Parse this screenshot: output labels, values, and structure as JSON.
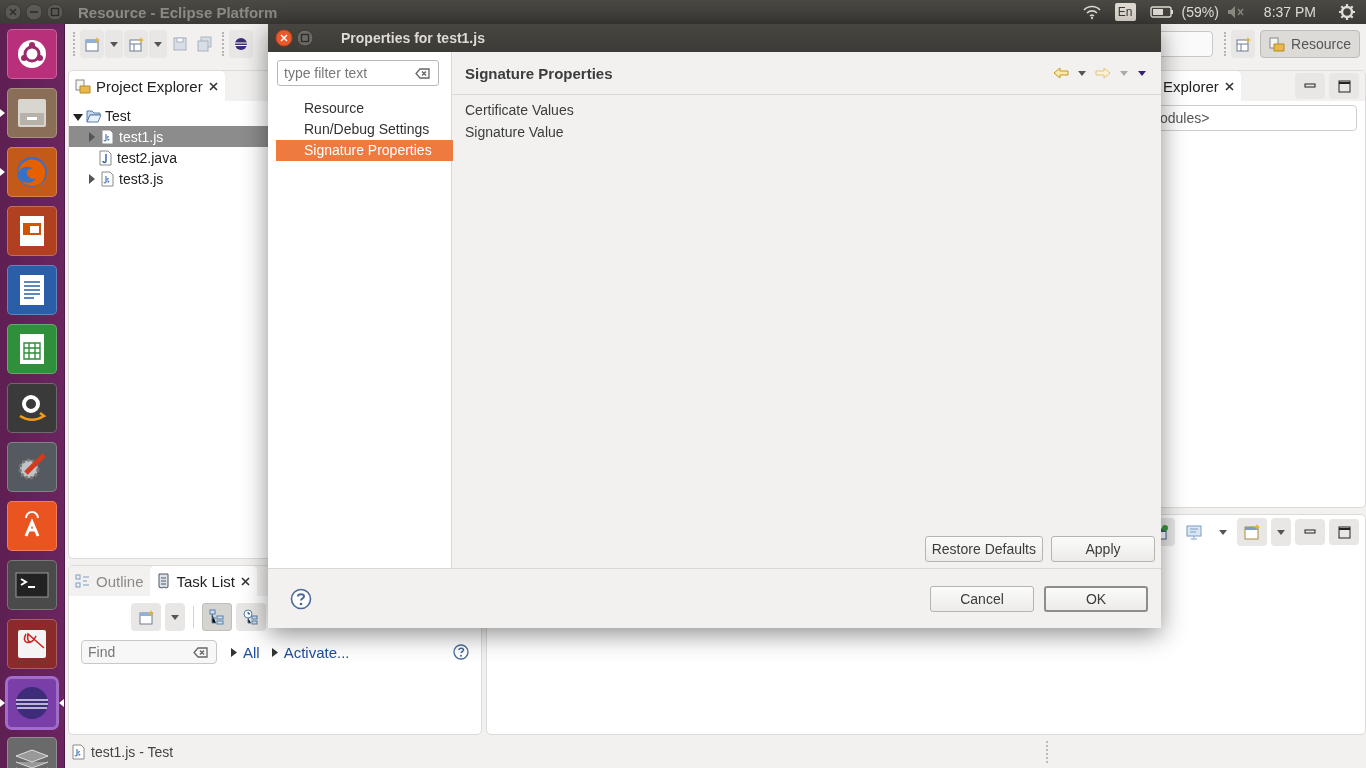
{
  "topbar": {
    "title": "Resource - Eclipse Platform",
    "keyboard": "En",
    "battery": "(59%)",
    "clock": "8:37 PM"
  },
  "launcher": [
    {
      "kind": "ubuntu",
      "running": false,
      "selected": false
    },
    {
      "kind": "files",
      "running": true,
      "selected": false
    },
    {
      "kind": "firefox",
      "running": true,
      "selected": false
    },
    {
      "kind": "impress",
      "running": false,
      "selected": false
    },
    {
      "kind": "writer",
      "running": false,
      "selected": false
    },
    {
      "kind": "calc",
      "running": false,
      "selected": false
    },
    {
      "kind": "amazon",
      "running": false,
      "selected": false
    },
    {
      "kind": "settings",
      "running": false,
      "selected": false
    },
    {
      "kind": "software",
      "running": false,
      "selected": false
    },
    {
      "kind": "terminal",
      "running": false,
      "selected": false
    },
    {
      "kind": "reader",
      "running": false,
      "selected": false
    },
    {
      "kind": "eclipse",
      "running": true,
      "selected": true
    },
    {
      "kind": "workspaces",
      "running": false,
      "selected": false
    }
  ],
  "perspective": {
    "label": "Resource",
    "selected": true
  },
  "project_explorer": {
    "title": "Project Explorer",
    "tree": [
      {
        "label": "Test",
        "expandable": true,
        "expanded": true,
        "selected": false,
        "children": [
          {
            "label": "test1.js",
            "kind": "js",
            "expandable": true,
            "expanded": false,
            "selected": true
          },
          {
            "label": "test2.java",
            "kind": "java",
            "expandable": false,
            "selected": false
          },
          {
            "label": "test3.js",
            "kind": "js",
            "expandable": true,
            "expanded": false,
            "selected": false
          }
        ]
      }
    ]
  },
  "right_panel": {
    "tab": "Explorer",
    "field_value": "odules>"
  },
  "tasks_panel": {
    "tabs": [
      {
        "label": "Outline",
        "selected": false
      },
      {
        "label": "Task List",
        "selected": true
      }
    ],
    "find_placeholder": "Find",
    "links": [
      "All",
      "Activate..."
    ]
  },
  "status_bar": "test1.js - Test",
  "dialog": {
    "title": "Properties for test1.js",
    "filter_placeholder": "type filter text",
    "nav": [
      {
        "label": "Resource",
        "selected": false
      },
      {
        "label": "Run/Debug Settings",
        "selected": false
      },
      {
        "label": "Signature Properties",
        "selected": true
      }
    ],
    "page_title": "Signature Properties",
    "fields": [
      "Certificate Values",
      "Signature Value"
    ],
    "page_buttons": [
      "Restore Defaults",
      "Apply"
    ],
    "buttons": [
      {
        "label": "Cancel",
        "default": false
      },
      {
        "label": "OK",
        "default": true
      }
    ]
  }
}
